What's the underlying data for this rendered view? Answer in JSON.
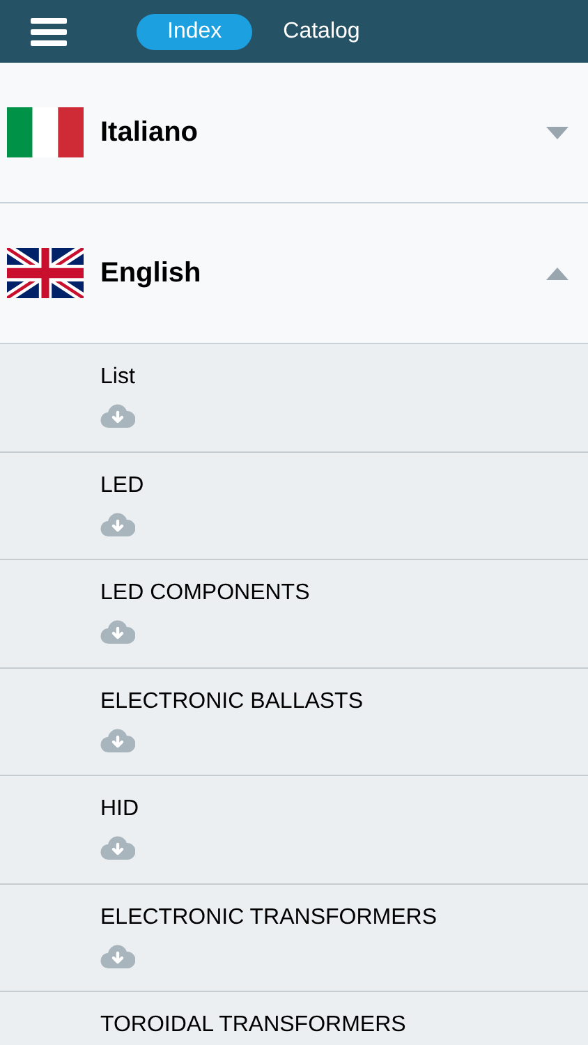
{
  "tabs": [
    {
      "label": "Index",
      "selected": true
    },
    {
      "label": "Catalog",
      "selected": false
    }
  ],
  "languages": [
    {
      "name": "Italiano",
      "kind": "italy",
      "expanded": false
    },
    {
      "name": "English",
      "kind": "uk",
      "expanded": true,
      "items": [
        {
          "title": "List",
          "download": true
        },
        {
          "title": "LED",
          "download": true
        },
        {
          "title": "LED COMPONENTS",
          "download": true
        },
        {
          "title": "ELECTRONIC BALLASTS",
          "download": true
        },
        {
          "title": "HID",
          "download": true
        },
        {
          "title": "ELECTRONIC TRANSFORMERS",
          "download": true
        },
        {
          "title": "TOROIDAL TRANSFORMERS"
        }
      ]
    }
  ]
}
